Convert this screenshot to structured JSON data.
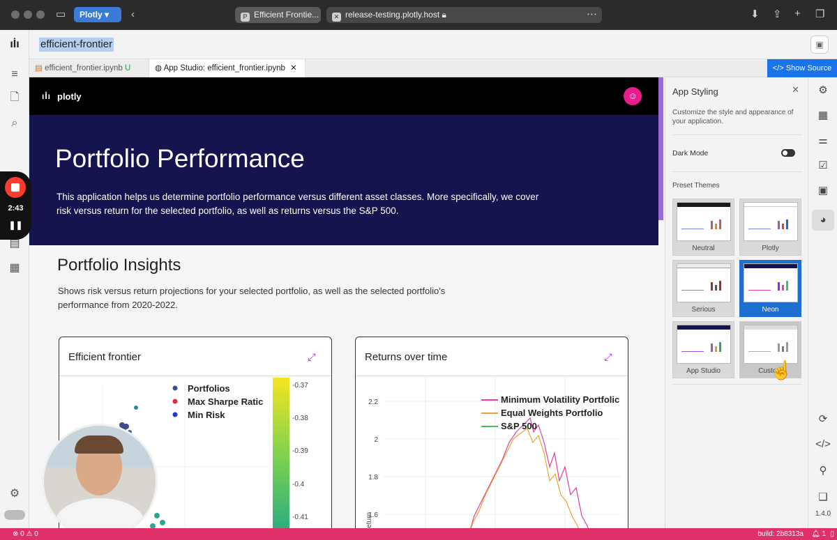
{
  "browser": {
    "tabs": [
      {
        "label": "Efficient Frontie...",
        "icon": "plotly-favicon-icon",
        "favicon_text": "P"
      },
      {
        "label": "release-testing.plotly.host",
        "icon": "x-favicon-icon",
        "favicon_text": "✕"
      }
    ],
    "profile": "Plotly"
  },
  "editor": {
    "file_title": "efficient-frontier",
    "tabs": [
      {
        "label": "efficient_frontier.ipynb",
        "badge": "U"
      },
      {
        "label": "App Studio: efficient_frontier.ipynb"
      }
    ],
    "show_source": "Show Source"
  },
  "app": {
    "brand": "plotly",
    "hero_title": "Portfolio Performance",
    "hero_text": "This application helps us determine portfolio performance versus different asset classes. More specifically, we cover risk versus return for the selected portfolio, as well as returns versus the S&P 500.",
    "insights_title": "Portfolio Insights",
    "insights_desc": "Shows risk versus return projections for your selected portfolio, as well as the selected portfolio's performance from 2020-2022.",
    "card1_title": "Efficient frontier",
    "card2_title": "Returns over time"
  },
  "recorder": {
    "time": "2:43"
  },
  "styling": {
    "title": "App Styling",
    "desc": "Customize the style and appearance of your application.",
    "dark_mode": "Dark Mode",
    "preset_themes": "Preset Themes",
    "themes": [
      "Neutral",
      "Plotly",
      "Serious",
      "Neon",
      "App Studio",
      "Custom"
    ],
    "selected_theme": "Neon"
  },
  "version": "1.4.0",
  "status": {
    "problems": "⊗ 0 ⚠ 0",
    "build": "build: 2b8313a",
    "alerts": "1"
  },
  "colors": {
    "accent": "#1a73e8",
    "hero": "#14144e",
    "status": "#e0306a",
    "pink": "#e91e8c",
    "expand": "#a020f0"
  },
  "chart_data": [
    {
      "type": "scatter",
      "title": "Efficient frontier",
      "series": [
        {
          "name": "Portfolios",
          "color": "#3b4d8a"
        },
        {
          "name": "Max Sharpe Ratic",
          "color": "#e0303a"
        },
        {
          "name": "Min Risk",
          "color": "#1a3bd8"
        }
      ],
      "colorbar": {
        "ticks": [
          "-0.37",
          "-0.38",
          "-0.39",
          "-0.4",
          "-0.41"
        ]
      }
    },
    {
      "type": "line",
      "title": "Returns over time",
      "series": [
        {
          "name": "Minimum Volatility Portfolic",
          "color": "#e040a0"
        },
        {
          "name": "Equal Weights Portfolio",
          "color": "#f0a030"
        },
        {
          "name": "S&P 500",
          "color": "#40c060"
        }
      ],
      "ylabel": "Return",
      "yticks": [
        "2.2",
        "2",
        "1.8",
        "1.6"
      ]
    }
  ]
}
